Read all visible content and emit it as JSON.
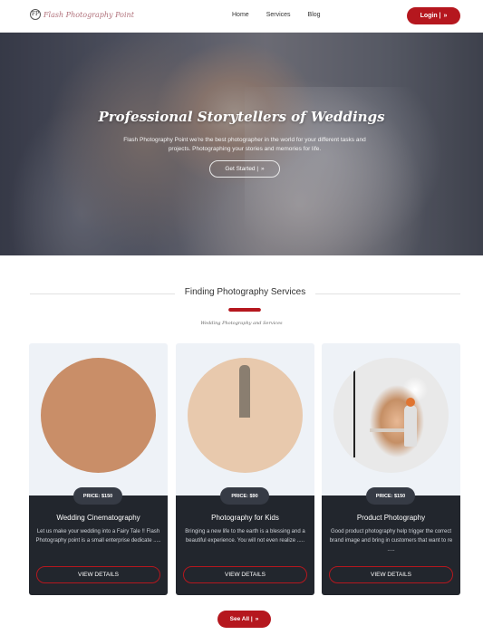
{
  "header": {
    "logo_mark": "FP",
    "logo_text": "Flash Photography Point",
    "nav": [
      "Home",
      "Services",
      "Blog"
    ],
    "login_label": "Login |",
    "login_icon": "double-chevron-right-icon"
  },
  "hero": {
    "title": "Professional Storytellers of Weddings",
    "description": "Flash Photography Point we're the best photographer in the world for your different tasks and projects. Photographing your stories and memories for life.",
    "button_label": "Get Started |"
  },
  "services": {
    "title": "Finding Photography Services",
    "subtitle": "Wedding Photography and Services",
    "cards": [
      {
        "price": "PRICE: $150",
        "title": "Wedding Cinematography",
        "description": "Let us make your wedding into a Fairy Tale !! Flash Photography point is a small enterprise dedicate .....",
        "button": "VIEW DETAILS"
      },
      {
        "price": "PRICE: $90",
        "title": "Photography for Kids",
        "description": "Bringing a new life to the earth is a blessing and a beautiful experience. You will not even realize .....",
        "button": "VIEW DETAILS"
      },
      {
        "price": "PRICE: $150",
        "title": "Product Photography",
        "description": "Good product photography help trigger the correct brand image and bring in customers that want to re .....",
        "button": "VIEW DETAILS"
      }
    ],
    "see_all_label": "See All |"
  },
  "colors": {
    "accent": "#b5171e",
    "card_dark": "#22262d",
    "card_light": "#eef2f7"
  }
}
